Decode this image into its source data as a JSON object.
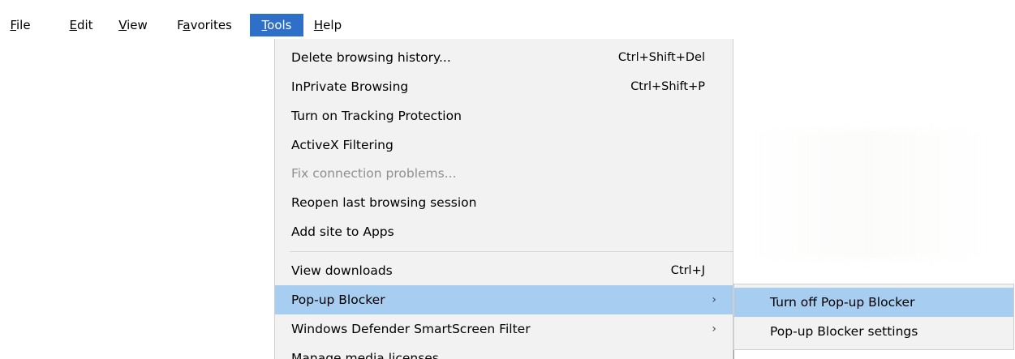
{
  "menubar": {
    "items": [
      {
        "mnemonic": "F",
        "rest": "ile"
      },
      {
        "mnemonic": "E",
        "rest": "dit"
      },
      {
        "mnemonic": "V",
        "rest": "iew"
      },
      {
        "pre": "F",
        "mnemonic": "a",
        "rest": "vorites"
      },
      {
        "mnemonic": "T",
        "rest": "ools"
      },
      {
        "mnemonic": "H",
        "rest": "elp"
      }
    ],
    "active_color": "#2e6fc8"
  },
  "tools_menu": {
    "items": [
      {
        "label": "Delete browsing history...",
        "shortcut": "Ctrl+Shift+Del"
      },
      {
        "label": "InPrivate Browsing",
        "shortcut": "Ctrl+Shift+P"
      },
      {
        "label": "Turn on Tracking Protection"
      },
      {
        "label": "ActiveX Filtering"
      },
      {
        "label": "Fix connection problems..."
      },
      {
        "label": "Reopen last browsing session"
      },
      {
        "label": "Add site to Apps"
      },
      {
        "label": "View downloads",
        "shortcut": "Ctrl+J"
      },
      {
        "label": "Pop-up Blocker",
        "arrow": "›"
      },
      {
        "label": "Windows Defender SmartScreen Filter",
        "arrow": "›"
      },
      {
        "label": "Manage media licenses"
      }
    ],
    "highlight_color": "#a7cdf0"
  },
  "popup_submenu": {
    "items": [
      {
        "label": "Turn off Pop-up Blocker"
      },
      {
        "label": "Pop-up Blocker settings"
      }
    ]
  }
}
